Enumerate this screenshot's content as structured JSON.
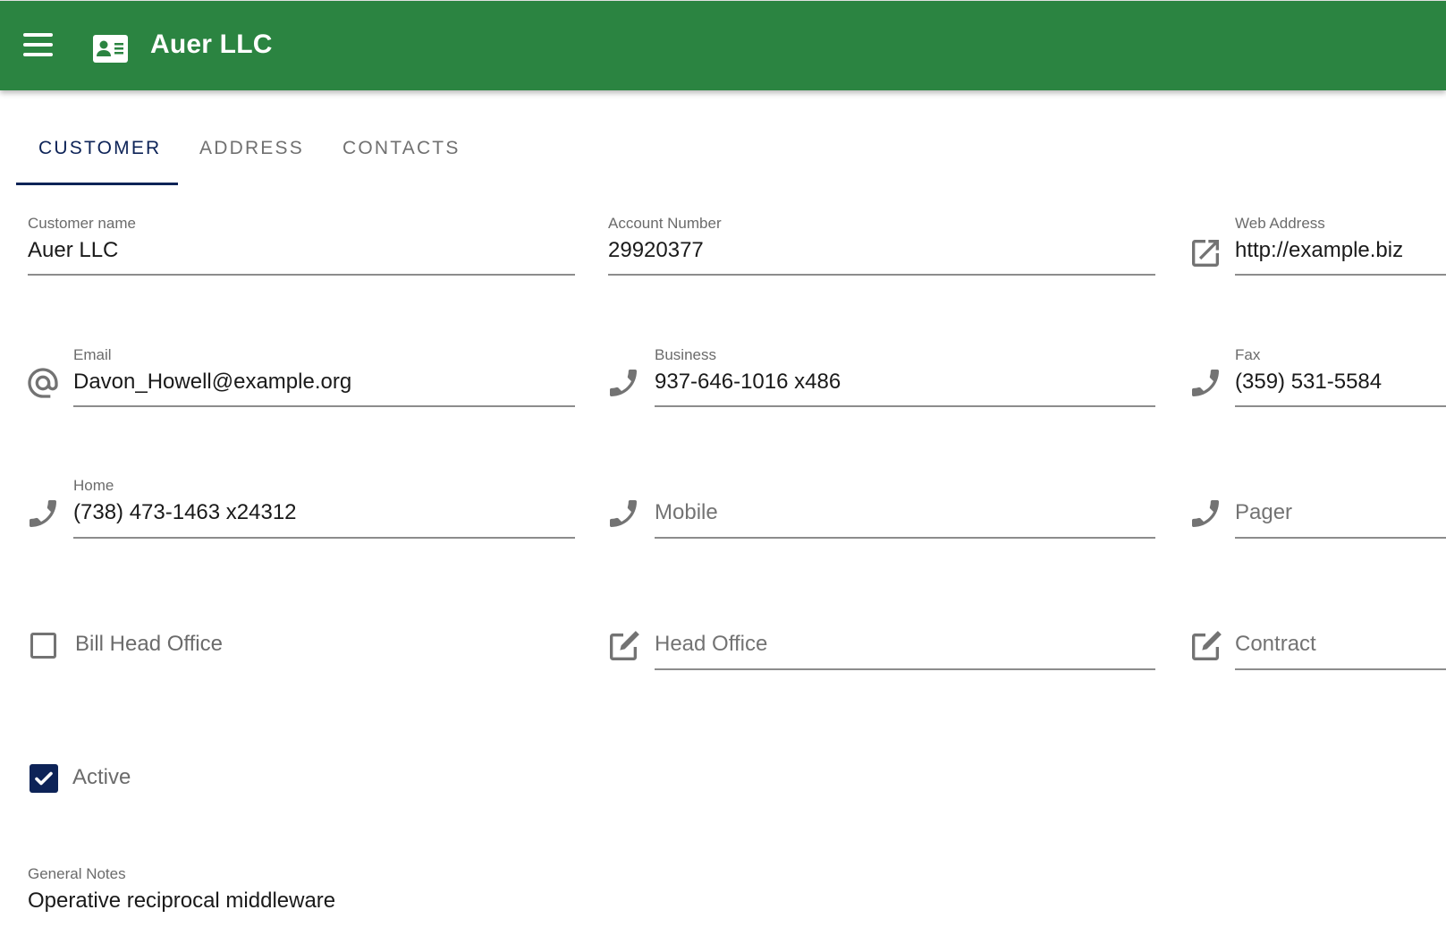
{
  "header": {
    "title": "Auer LLC",
    "menu_icon": "hamburger-menu-icon",
    "app_icon": "contact-card-icon",
    "background_color": "#2b8441"
  },
  "tabs": [
    {
      "label": "CUSTOMER",
      "active": true
    },
    {
      "label": "ADDRESS",
      "active": false
    },
    {
      "label": "CONTACTS",
      "active": false
    }
  ],
  "accent_color": "#0d2357",
  "fields": {
    "customer_name": {
      "label": "Customer name",
      "value": "Auer LLC"
    },
    "account_number": {
      "label": "Account Number",
      "value": "29920377"
    },
    "web_address": {
      "label": "Web Address",
      "value": "http://example.biz",
      "icon": "external-link-icon"
    },
    "email": {
      "label": "Email",
      "value": "Davon_Howell@example.org",
      "icon": "at-sign-icon"
    },
    "business": {
      "label": "Business",
      "value": "937-646-1016 x486",
      "icon": "phone-icon"
    },
    "fax": {
      "label": "Fax",
      "value": "(359) 531-5584",
      "icon": "phone-icon"
    },
    "home": {
      "label": "Home",
      "value": "(738) 473-1463 x24312",
      "icon": "phone-icon"
    },
    "mobile": {
      "placeholder": "Mobile",
      "value": "",
      "icon": "phone-icon"
    },
    "pager": {
      "placeholder": "Pager",
      "value": "",
      "icon": "phone-icon"
    },
    "head_office": {
      "placeholder": "Head Office",
      "value": "",
      "icon": "edit-icon"
    },
    "contract": {
      "placeholder": "Contract",
      "value": "",
      "icon": "edit-icon"
    },
    "general_notes": {
      "label": "General Notes",
      "value": "Operative reciprocal middleware"
    }
  },
  "checkboxes": {
    "bill_head_office": {
      "label": "Bill Head Office",
      "checked": false
    },
    "active": {
      "label": "Active",
      "checked": true
    }
  }
}
